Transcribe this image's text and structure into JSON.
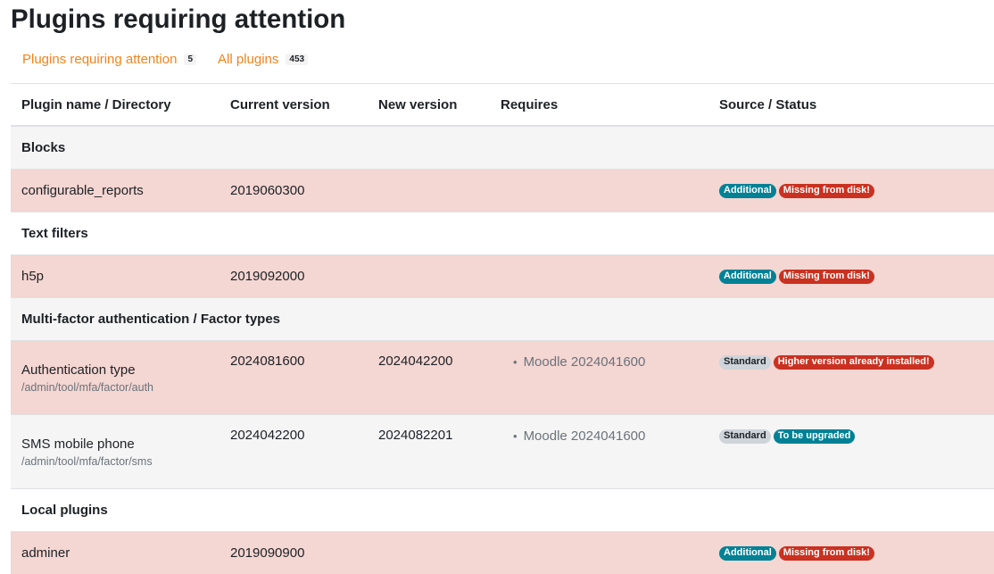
{
  "page": {
    "title": "Plugins requiring attention"
  },
  "tabs": [
    {
      "label": "Plugins requiring attention",
      "count": "5"
    },
    {
      "label": "All plugins",
      "count": "453"
    }
  ],
  "table": {
    "headers": [
      "Plugin name / Directory",
      "Current version",
      "New version",
      "Requires",
      "Source / Status"
    ],
    "categories": [
      {
        "name": "Blocks",
        "plugins": [
          {
            "name": "configurable_reports",
            "current": "2019060300",
            "source": "Additional",
            "status": "Missing from disk!"
          }
        ]
      },
      {
        "name": "Text filters",
        "plugins": [
          {
            "name": "h5p",
            "current": "2019092000",
            "source": "Additional",
            "status": "Missing from disk!"
          }
        ]
      },
      {
        "name": "Multi-factor authentication / Factor types",
        "plugins": [
          {
            "name": "Authentication type",
            "dir": "/admin/tool/mfa/factor/auth",
            "current": "2024081600",
            "new": "2024042200",
            "requires": "Moodle 2024041600",
            "source": "Standard",
            "status": "Higher version already installed!"
          },
          {
            "name": "SMS mobile phone",
            "dir": "/admin/tool/mfa/factor/sms",
            "current": "2024042200",
            "new": "2024082201",
            "requires": "Moodle 2024041600",
            "source": "Standard",
            "status": "To be upgraded"
          }
        ]
      },
      {
        "name": "Local plugins",
        "plugins": [
          {
            "name": "adminer",
            "current": "2019090900",
            "source": "Additional",
            "status": "Missing from disk!"
          }
        ]
      }
    ]
  },
  "colors": {
    "link": "#f0841a",
    "row_attention": "#f4d6d2",
    "row_light": "#f5f5f5",
    "badge_info": "#008196",
    "badge_danger": "#ca3120",
    "badge_secondary": "#ced4da"
  }
}
